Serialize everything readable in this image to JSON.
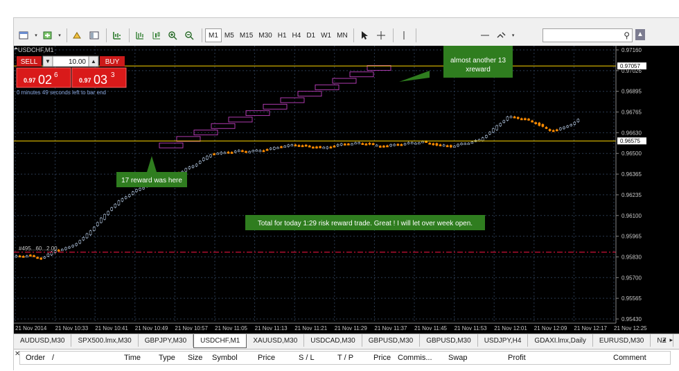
{
  "toolbar": {
    "timeframes": [
      "M1",
      "M5",
      "M15",
      "M30",
      "H1",
      "H4",
      "D1",
      "W1",
      "MN"
    ],
    "search_placeholder": ""
  },
  "chart": {
    "symbol_title": "USDCHF,M1",
    "sell_label": "SELL",
    "buy_label": "BUY",
    "lot_value": "10.00",
    "sell_price_small": "0.97",
    "sell_price_big": "02",
    "sell_price_sup": "6",
    "buy_price_small": "0.97",
    "buy_price_big": "03",
    "buy_price_sup": "3",
    "countdown": "0 minutes 49 seconds left to bar end",
    "order_line_label": "#495...60...2.00",
    "callouts": {
      "top": [
        "almost another 13",
        "xreward"
      ],
      "left": "17 reward was here",
      "center": "Total for today 1:29 risk reward trade. Great ! I will let over week open."
    },
    "colors": {
      "background": "#000000",
      "bull_candle": "#b0c4de",
      "bear_candle": "#ff8c00",
      "level_line": "#ffd700",
      "order_line": "#dc143c",
      "rr_boxes": "#c040c0",
      "callout": "#2f7d1f"
    }
  },
  "chart_data": {
    "type": "line",
    "title": "USDCHF,M1",
    "x": [
      "21 Nov 2014",
      "21 Nov 10:33",
      "21 Nov 10:41",
      "21 Nov 10:49",
      "21 Nov 10:57",
      "21 Nov 11:05",
      "21 Nov 11:13",
      "21 Nov 11:21",
      "21 Nov 11:29",
      "21 Nov 11:37",
      "21 Nov 11:45",
      "21 Nov 11:53",
      "21 Nov 12:01",
      "21 Nov 12:09",
      "21 Nov 12:17",
      "21 Nov 12:25"
    ],
    "y_ticks": [
      "0.97160",
      "0.97026",
      "0.96895",
      "0.96765",
      "0.96630",
      "0.96500",
      "0.96365",
      "0.96235",
      "0.96100",
      "0.95965",
      "0.95830",
      "0.95700",
      "0.95565",
      "0.95430"
    ],
    "price_tags": [
      "0.97057",
      "0.96575"
    ],
    "ylim": [
      0.9543,
      0.9716
    ],
    "levels": [
      0.97057,
      0.96575,
      0.9586
    ],
    "series": [
      {
        "values": [
          0.9583,
          0.9584,
          0.9582,
          0.9587,
          0.9589,
          0.9595,
          0.9605,
          0.9615,
          0.9622,
          0.9627,
          0.9631,
          0.9636,
          0.9638,
          0.9643,
          0.9649,
          0.965,
          0.9651,
          0.9651,
          0.9652,
          0.9654,
          0.9655,
          0.9654,
          0.9653,
          0.9655,
          0.9656,
          0.9656,
          0.9654,
          0.9655,
          0.9656,
          0.9657,
          0.9655,
          0.9654,
          0.9656,
          0.9658,
          0.9665,
          0.9673,
          0.9672,
          0.9669,
          0.9664,
          0.9666,
          0.9671
        ]
      }
    ]
  },
  "tabs": [
    "AUDUSD,M30",
    "SPX500.lmx,M30",
    "GBPJPY,M30",
    "USDCHF,M1",
    "XAUUSD,M30",
    "USDCAD,M30",
    "GBPUSD,M30",
    "GBPUSD,M30",
    "USDJPY,H4",
    "GDAXI.lmx,Daily",
    "EURUSD,M30",
    "NZ"
  ],
  "active_tab": "USDCHF,M1",
  "terminal": {
    "columns": [
      "Order",
      "/",
      "Time",
      "Type",
      "Size",
      "Symbol",
      "Price",
      "S / L",
      "T / P",
      "Price",
      "Commis...",
      "Swap",
      "Profit",
      "Comment"
    ]
  }
}
